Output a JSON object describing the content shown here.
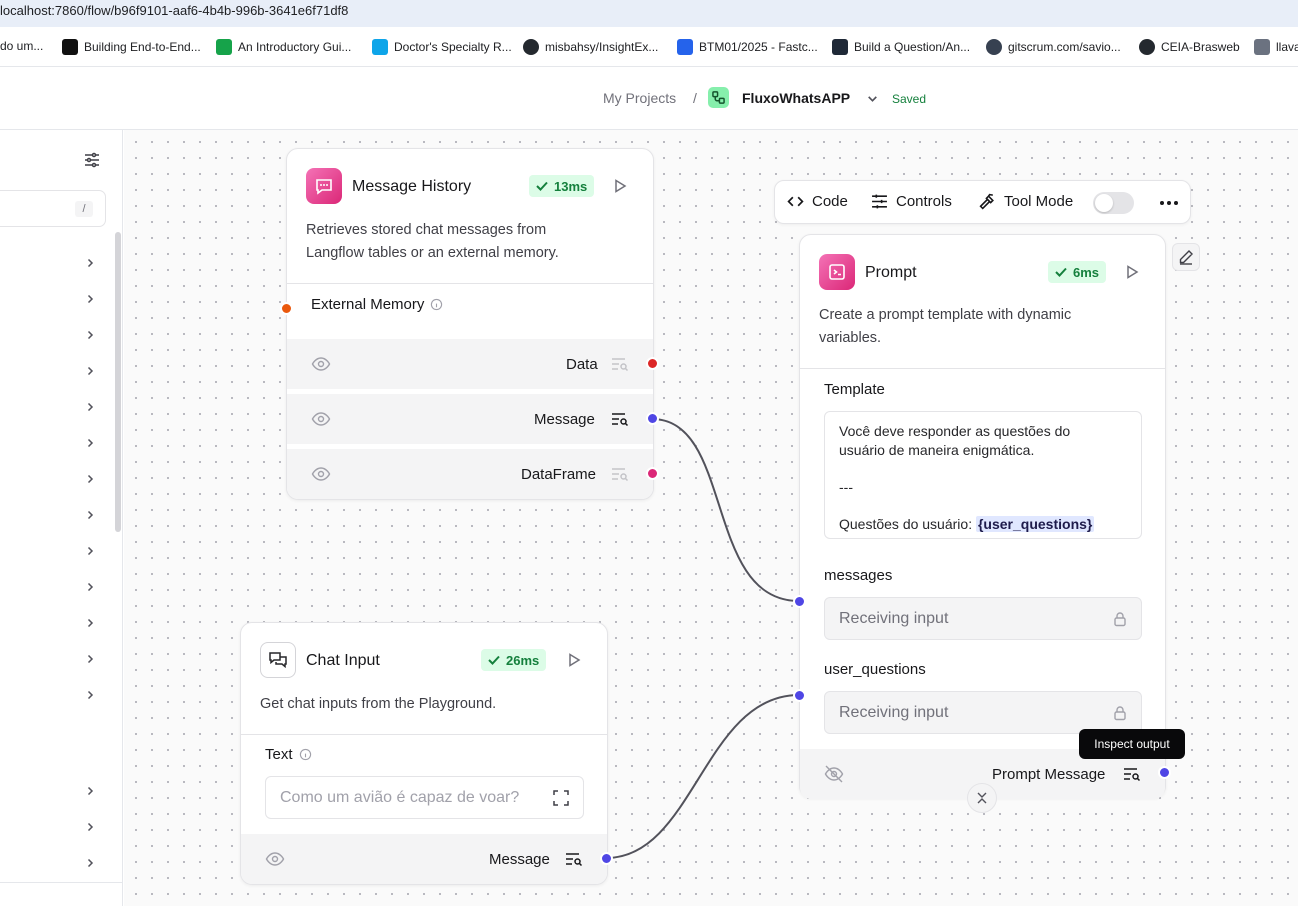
{
  "browser": {
    "url": "localhost:7860/flow/b96f9101-aaf6-4b4b-996b-3641e6f71df8",
    "bookmarks": [
      {
        "label": "do um...",
        "icon": "partial-icon",
        "color": "#4b5563"
      },
      {
        "label": "Building End-to-End...",
        "icon": "medium-icon",
        "color": "#111111"
      },
      {
        "label": "An Introductory Gui...",
        "icon": "flower-icon",
        "color": "#16a34a"
      },
      {
        "label": "Doctor's Specialty R...",
        "icon": "kaggle-icon",
        "color": "#0ea5e9"
      },
      {
        "label": "misbahsy/InsightEx...",
        "icon": "github-icon",
        "color": "#24292f"
      },
      {
        "label": "BTM01/2025 - Fastc...",
        "icon": "trello-icon",
        "color": "#2563eb"
      },
      {
        "label": "Build a Question/An...",
        "icon": "colab-icon",
        "color": "#1f2937"
      },
      {
        "label": "gitscrum.com/savio...",
        "icon": "globe-icon",
        "color": "#374151"
      },
      {
        "label": "CEIA-Brasweb",
        "icon": "github-icon",
        "color": "#24292f"
      },
      {
        "label": "llava",
        "icon": "book-icon",
        "color": "#6b7280"
      }
    ]
  },
  "header": {
    "projects": "My Projects",
    "separator": "/",
    "flow_name": "FluxoWhatsAPP",
    "status": "Saved",
    "status_color": "#15803d"
  },
  "sidebar": {
    "search_shortcut": "/"
  },
  "toolbar": {
    "code": "Code",
    "controls": "Controls",
    "tool_mode": "Tool Mode"
  },
  "nodes": {
    "message_history": {
      "title": "Message History",
      "timing": "13ms",
      "description_line1": "Retrieves stored chat messages from",
      "description_line2": "Langflow tables or an external memory.",
      "field_external_memory": "External Memory",
      "outputs": [
        {
          "label": "Data",
          "handle_color": "#dc2626"
        },
        {
          "label": "Message",
          "handle_color": "#4f46e5"
        },
        {
          "label": "DataFrame",
          "handle_color": "#db2777"
        }
      ]
    },
    "chat_input": {
      "title": "Chat Input",
      "timing": "26ms",
      "description": "Get chat inputs from the Playground.",
      "field_text": "Text",
      "text_placeholder": "Como um avião é capaz de voar?",
      "output": "Message"
    },
    "prompt": {
      "title": "Prompt",
      "timing": "6ms",
      "description_line1": "Create a prompt template with dynamic",
      "description_line2": "variables.",
      "template_label": "Template",
      "template_line1": "Você deve responder as questões do",
      "template_line2": "usuário de maneira enigmática.",
      "template_line3": "---",
      "template_line4_prefix": "Questões do usuário: ",
      "template_var": "{user_questions}",
      "messages_label": "messages",
      "messages_value": "Receiving input",
      "user_questions_label": "user_questions",
      "user_questions_value": "Receiving input",
      "output": "Prompt Message"
    }
  },
  "tooltip": "Inspect output",
  "colors": {
    "accent_pink": "#db2777",
    "handle_indigo": "#4f46e5",
    "handle_orange": "#ea580c",
    "success_bg": "#dcfce7",
    "success_text": "#15803d"
  }
}
